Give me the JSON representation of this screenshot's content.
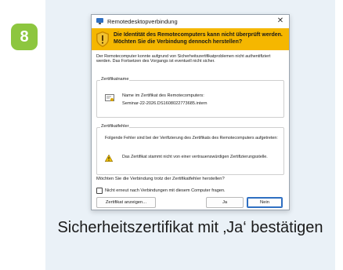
{
  "step": {
    "number": "8",
    "badge_color": "#8dc63f"
  },
  "dialog": {
    "title": "Remotedesktopverbindung",
    "close_glyph": "✕",
    "warning_banner": "Die Identität des Remotecomputers kann nicht überprüft werden. Möchten Sie die Verbindung dennoch herstellen?",
    "banner_color": "#f5b700",
    "intro_text": "Der Remotecomputer konnte aufgrund von Sicherheitszertifikatproblemen nicht authentifiziert werden. Das Fortsetzen des Vorgangs ist eventuell nicht sicher.",
    "certificate_name": {
      "group_label": "Zertifikatname",
      "label": "Name im Zertifikat des Remotecomputers:",
      "value": "Seminar-22-2026.DS1608022773685.intern"
    },
    "certificate_errors": {
      "group_label": "Zertifikatfehler",
      "description": "Folgende Fehler sind bei der Verifizierung des Zertifikats des Remotecomputers aufgetreten:",
      "error": "Das Zertifikat stammt nicht von einer vertrauenswürdigen Zertifizierungsstelle."
    },
    "question": "Möchten Sie die Verbindung trotz der Zertifikatfehler herstellen?",
    "checkbox_label": "Nicht erneut nach Verbindungen mit diesem Computer fragen.",
    "checkbox_checked": false,
    "buttons": {
      "view_certificate": "Zertifikat anzeigen...",
      "yes": "Ja",
      "no": "Nein"
    }
  },
  "caption": "Sicherheitszertifikat mit ‚Ja‘ bestätigen"
}
